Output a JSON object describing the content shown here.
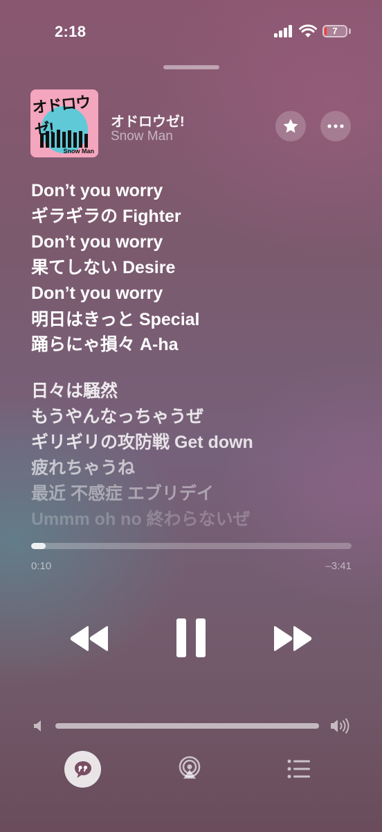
{
  "status_bar": {
    "time": "2:18",
    "battery_percent": "7",
    "battery_color": "#ff3b30"
  },
  "now_playing": {
    "artwork_title": "オドロウゼ!",
    "artwork_band": "Snow Man",
    "title": "オドロウゼ!",
    "artist": "Snow Man",
    "favorite_icon": "star-icon",
    "more_icon": "ellipsis-icon"
  },
  "lyrics": [
    {
      "text": "Don’t you worry",
      "state": "active"
    },
    {
      "text": "ギラギラの Fighter",
      "state": "active"
    },
    {
      "text": "Don’t you worry",
      "state": "active"
    },
    {
      "text": "果てしない Desire",
      "state": "active"
    },
    {
      "text": "Don’t you worry",
      "state": "active"
    },
    {
      "text": "明日はきっと Special",
      "state": "active"
    },
    {
      "text": "踊らにゃ損々 A-ha",
      "state": "active"
    },
    {
      "text": "日々は騒然",
      "state": "upcoming"
    },
    {
      "text": "もうやんなっちゃうぜ",
      "state": "upcoming"
    },
    {
      "text": "ギリギリの攻防戦 Get down",
      "state": "upcoming"
    },
    {
      "text": "疲れちゃうね",
      "state": "upcoming"
    },
    {
      "text": "最近 不感症 エブリデイ",
      "state": "upcoming"
    },
    {
      "text": "Ummm oh no 終わらないぜ",
      "state": "upcoming"
    }
  ],
  "playback": {
    "elapsed": "0:10",
    "remaining": "–3:41",
    "progress_fraction": 0.045
  },
  "controls": {
    "rewind_icon": "rewind-icon",
    "pause_icon": "pause-icon",
    "forward_icon": "fast-forward-icon"
  },
  "volume": {
    "level_fraction": 1.0
  },
  "bottom_bar": {
    "lyrics_icon": "lyrics-quote-icon",
    "airplay_icon": "airplay-icon",
    "queue_icon": "queue-list-icon"
  }
}
